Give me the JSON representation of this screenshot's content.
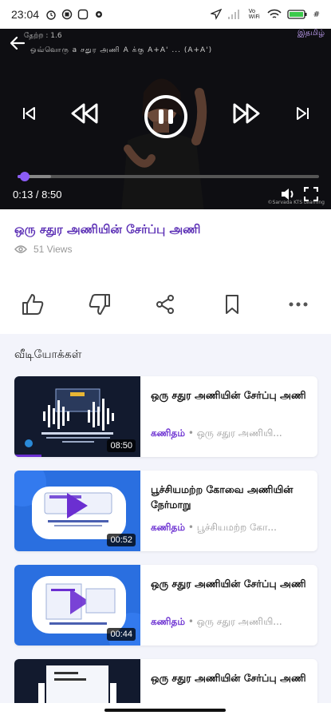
{
  "status_bar": {
    "time": "23:04",
    "wifi_label": "Vo WiFi",
    "battery_icon": "battery-icon"
  },
  "player": {
    "board_top": "தேற்ற : 1.6",
    "board_text": "ஒவ்வொரு  a  சதுர அணி  A க்கு  A+A' ... (A+A')",
    "brand": "இதமிழ்",
    "current_time": "0:13",
    "duration": "8:50",
    "timecode": "0:13 / 8:50",
    "progress": 0.025,
    "buffered": 0.11,
    "watermark": "©Sarvada KTS Learning",
    "accent": "#8b5cf6"
  },
  "video": {
    "title": "ஒரு சதுர அணியின் சேர்ப்பு அணி",
    "views": "51 Views"
  },
  "actions": [
    {
      "name": "like",
      "icon": "thumbs-up-icon"
    },
    {
      "name": "dislike",
      "icon": "thumbs-down-icon"
    },
    {
      "name": "share",
      "icon": "share-icon"
    },
    {
      "name": "bookmark",
      "icon": "bookmark-icon"
    },
    {
      "name": "more",
      "icon": "more-horizontal-icon"
    }
  ],
  "videos_section": {
    "title": "வீடியோக்கள்",
    "items": [
      {
        "title": "ஒரு சதுர அணியின் சேர்ப்பு அணி",
        "subject": "கணிதம்",
        "subtitle": " • ஒரு சதுர அணியி...",
        "duration": "08:50",
        "watched": 0.09
      },
      {
        "title": "பூச்சியமற்ற கோவை அணியின் நேர்மாறு",
        "subject": "கணிதம்",
        "subtitle": " • பூச்சியமற்ற கோ...",
        "duration": "00:52",
        "watched": 0
      },
      {
        "title": "ஒரு சதுர அணியின் சேர்ப்பு அணி",
        "subject": "கணிதம்",
        "subtitle": " • ஒரு சதுர அணியி...",
        "duration": "00:44",
        "watched": 0
      },
      {
        "title": "ஒரு சதுர அணியின் சேர்ப்பு அணி",
        "subject": "",
        "subtitle": "",
        "duration": "",
        "watched": 0
      }
    ]
  },
  "colors": {
    "accent": "#6b2fd1",
    "title": "#5b2fb5",
    "section_bg": "#f3f4fb"
  }
}
